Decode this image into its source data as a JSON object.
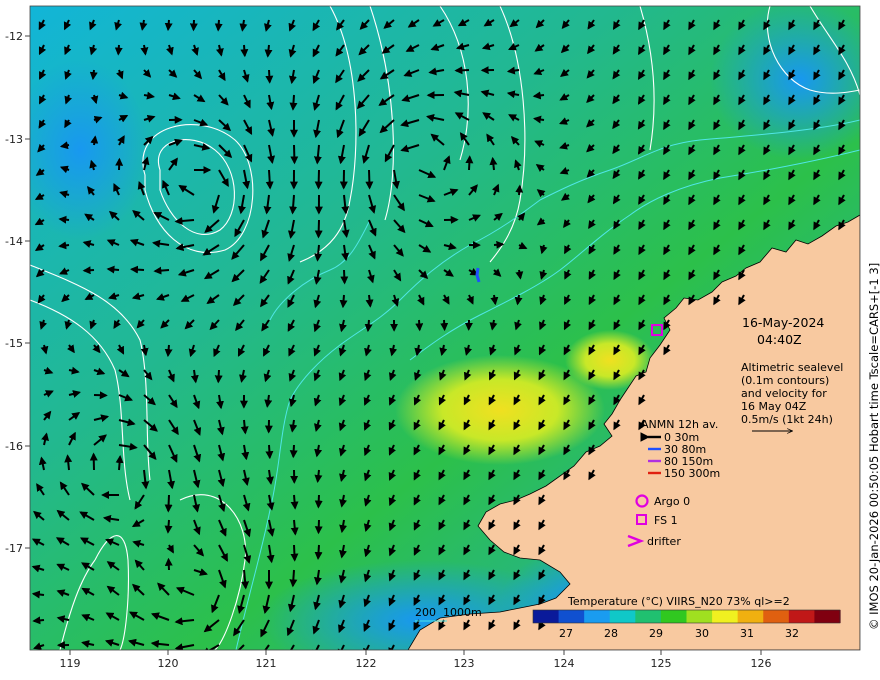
{
  "map": {
    "lon_ticks": [
      "119",
      "120",
      "121",
      "122",
      "123",
      "124",
      "125",
      "126"
    ],
    "lat_ticks": [
      "-12",
      "-13",
      "-14",
      "-15",
      "-16",
      "-17"
    ]
  },
  "date": {
    "day": "16-May-2024",
    "time": "04:40Z"
  },
  "description": [
    "Altimetric sealevel",
    "(0.1m contours)",
    "and velocity for",
    "16 May 04Z",
    "0.5m/s (1kt 24h)"
  ],
  "anmn": {
    "title": "ANMN 12h av.",
    "items": [
      {
        "label": "0 30m",
        "color": "#000000"
      },
      {
        "label": "30 80m",
        "color": "#1f4fff"
      },
      {
        "label": "80 150m",
        "color": "#b030e0"
      },
      {
        "label": "150 300m",
        "color": "#e02010"
      }
    ]
  },
  "markers": [
    {
      "label": "Argo 0",
      "icon": "circle-icon",
      "color": "#e000e0"
    },
    {
      "label": "FS 1",
      "icon": "square-icon",
      "color": "#e000e0"
    },
    {
      "label": "drifter",
      "icon": "chevron-icon",
      "color": "#e000e0"
    }
  ],
  "depth_legend": "200  1000m",
  "colorbar": {
    "title": "Temperature (°C) VIIRS_N20 73% ql>=2",
    "ticks": [
      "27",
      "28",
      "29",
      "30",
      "31",
      "32"
    ],
    "colors": [
      "#0a1a9a",
      "#1050d0",
      "#1a9cf0",
      "#10c8c8",
      "#20c070",
      "#30c820",
      "#a0e020",
      "#f0f020",
      "#f0b010",
      "#e06010",
      "#c01818",
      "#800010"
    ]
  },
  "side_label": "© IMOS 20-Jan-2026 00:50:05 Hobart time Tscale=CARS+[-1 3]",
  "colors": {
    "land": "#f8c9a0",
    "contour": "#ffffff",
    "isobath": "#40e0e0",
    "arrow": "#000000"
  }
}
